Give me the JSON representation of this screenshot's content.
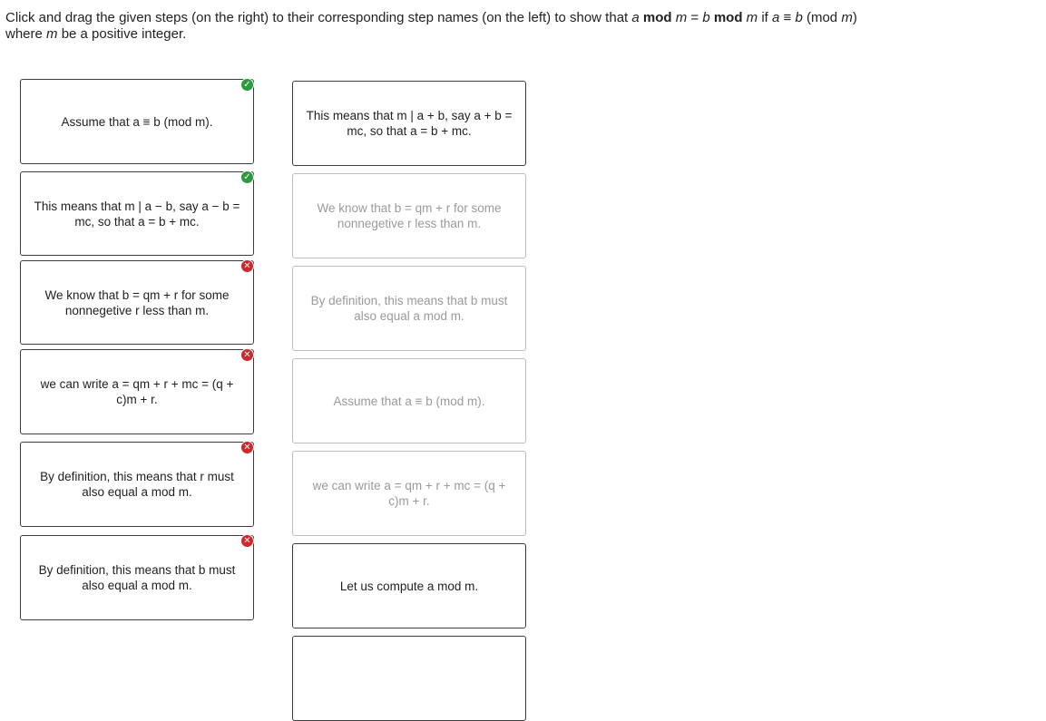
{
  "instructions": {
    "part1": "Click and drag the given steps (on the right) to their corresponding step names (on the left) to show that ",
    "a": "a",
    "mod1": " mod ",
    "m1": "m",
    "eq": " = ",
    "b": "b",
    "mod2": " mod ",
    "m2": "m",
    "if": " if ",
    "a2": "a",
    "equiv": " ≡ ",
    "b2": "b",
    "paren_open": " (mod ",
    "m3": "m",
    "paren_close": ") where ",
    "m4": "m",
    "tail": " be a positive integer."
  },
  "left_slots": [
    {
      "text": "Assume that a ≡ b (mod m).",
      "status": "correct",
      "icon": "check-icon"
    },
    {
      "text": "This means that m | a − b, say a − b = mc, so that a = b + mc.",
      "status": "correct",
      "icon": "check-icon"
    },
    {
      "text": "We know that b = qm + r for some nonnegetive r less than m.",
      "status": "incorrect",
      "icon": "x-icon"
    },
    {
      "text": "we can write a = qm + r + mc = (q + c)m + r.",
      "status": "incorrect",
      "icon": "x-icon"
    },
    {
      "text": "By definition, this means that r must also equal a mod m.",
      "status": "incorrect",
      "icon": "x-icon"
    },
    {
      "text": "By definition, this means that b must also equal a mod m.",
      "status": "incorrect",
      "icon": "x-icon"
    }
  ],
  "right_steps": [
    {
      "text": "This means that m | a + b, say a + b = mc, so that a = b + mc.",
      "faded": false
    },
    {
      "text": "We know that b = qm + r for some nonnegetive r less than m.",
      "faded": true
    },
    {
      "text": "By definition, this means that b must also equal a mod m.",
      "faded": true
    },
    {
      "text": "Assume that a ≡ b (mod m).",
      "faded": true
    },
    {
      "text": "we can write a = qm + r + mc = (q + c)m + r.",
      "faded": true
    },
    {
      "text": "Let us compute a mod m.",
      "faded": false
    }
  ],
  "colors": {
    "correct": "#2e9a3e",
    "incorrect": "#d0262c",
    "border": "#3d3d3d",
    "faded_border": "#bdbdbd"
  }
}
